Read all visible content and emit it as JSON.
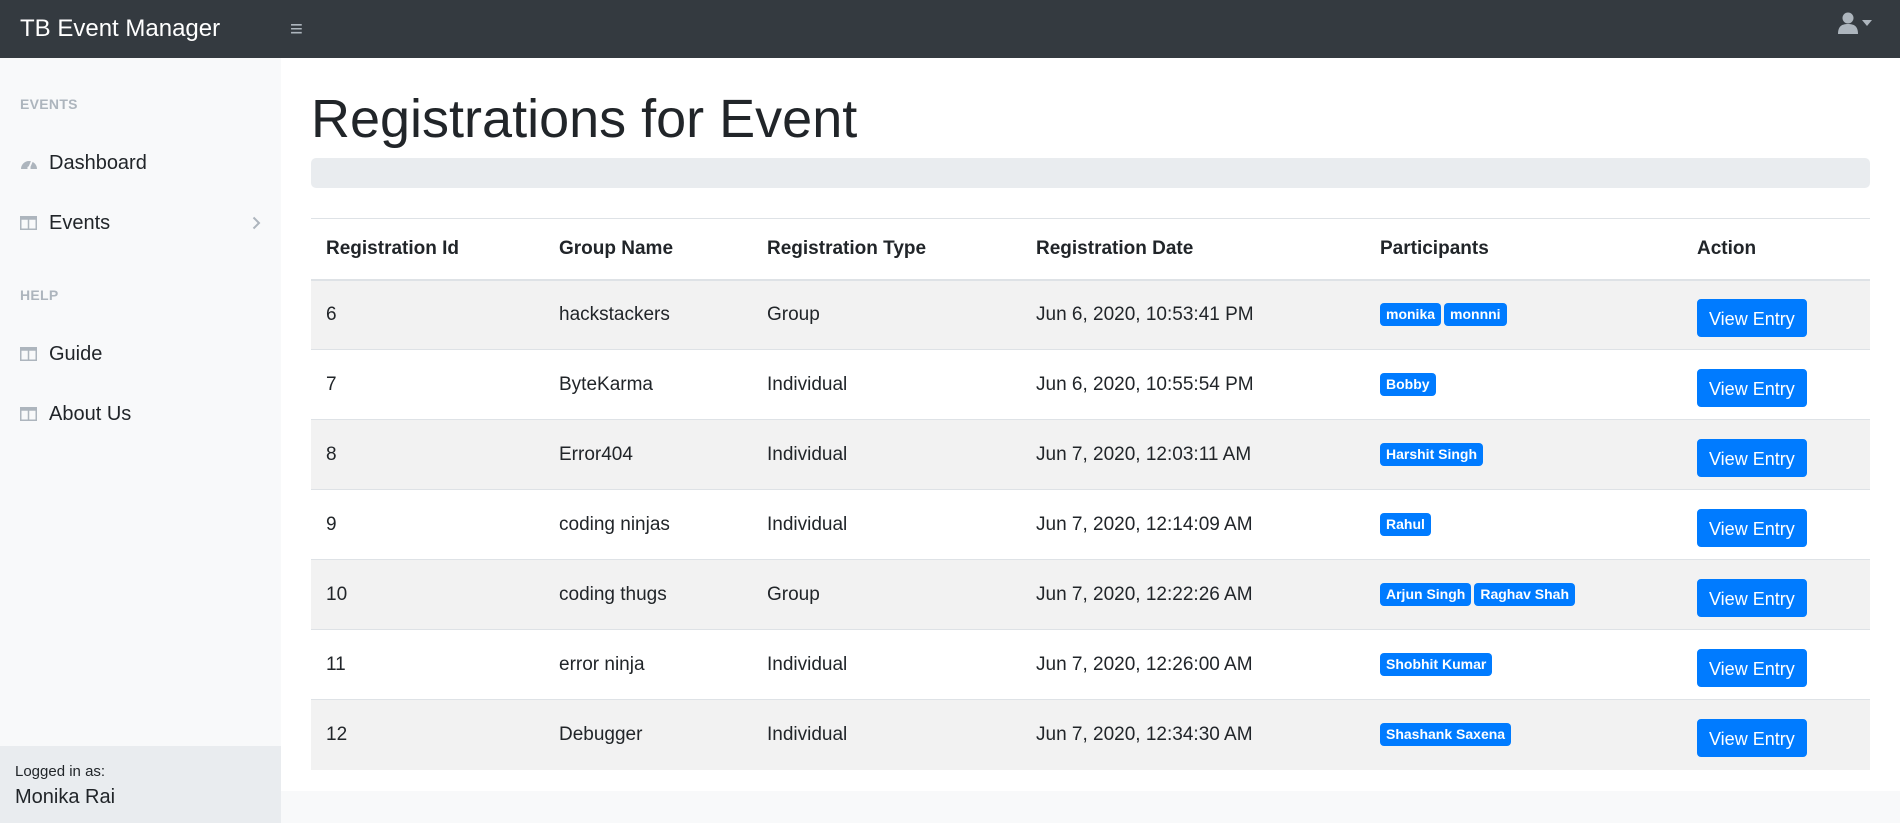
{
  "navbar": {
    "brand": "TB Event Manager",
    "toggle_icon": "hamburger-icon",
    "user_icon": "user-icon"
  },
  "sidebar": {
    "sections": [
      {
        "heading": "EVENTS"
      },
      {
        "heading": "HELP"
      }
    ],
    "items": [
      {
        "label": "Dashboard",
        "icon": "dashboard-icon"
      },
      {
        "label": "Events",
        "icon": "table-icon"
      },
      {
        "label": "Guide",
        "icon": "table-icon"
      },
      {
        "label": "About Us",
        "icon": "table-icon"
      }
    ],
    "footer": {
      "caption": "Logged in as:",
      "user": "Monika Rai"
    }
  },
  "main": {
    "title": "Registrations for Event",
    "table": {
      "headers": [
        "Registration Id",
        "Group Name",
        "Registration Type",
        "Registration Date",
        "Participants",
        "Action"
      ],
      "rows": [
        {
          "id": "6",
          "group": "hackstackers",
          "type": "Group",
          "date": "Jun 6, 2020, 10:53:41 PM",
          "participants": [
            "monika",
            "monnni"
          ],
          "action": "View Entry"
        },
        {
          "id": "7",
          "group": "ByteKarma",
          "type": "Individual",
          "date": "Jun 6, 2020, 10:55:54 PM",
          "participants": [
            "Bobby"
          ],
          "action": "View Entry"
        },
        {
          "id": "8",
          "group": "Error404",
          "type": "Individual",
          "date": "Jun 7, 2020, 12:03:11 AM",
          "participants": [
            "Harshit Singh"
          ],
          "action": "View Entry"
        },
        {
          "id": "9",
          "group": "coding ninjas",
          "type": "Individual",
          "date": "Jun 7, 2020, 12:14:09 AM",
          "participants": [
            "Rahul"
          ],
          "action": "View Entry"
        },
        {
          "id": "10",
          "group": "coding thugs",
          "type": "Group",
          "date": "Jun 7, 2020, 12:22:26 AM",
          "participants": [
            "Arjun Singh",
            "Raghav Shah"
          ],
          "action": "View Entry"
        },
        {
          "id": "11",
          "group": "error ninja",
          "type": "Individual",
          "date": "Jun 7, 2020, 12:26:00 AM",
          "participants": [
            "Shobhit Kumar"
          ],
          "action": "View Entry"
        },
        {
          "id": "12",
          "group": "Debugger",
          "type": "Individual",
          "date": "Jun 7, 2020, 12:34:30 AM",
          "participants": [
            "Shashank Saxena"
          ],
          "action": "View Entry"
        }
      ]
    }
  },
  "colors": {
    "navbar": "#343a40",
    "primary": "#007bff",
    "sidebar": "#f8f9fa",
    "muted": "#adb5bd"
  }
}
